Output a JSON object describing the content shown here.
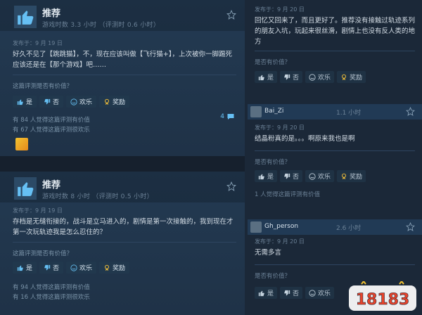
{
  "reviews": [
    {
      "title": "推荐",
      "hours": "游戏时数 3.3 小时 （评测时 0.6 小时）",
      "posted": "发布于：9 月 19 日",
      "text": "好久不见了【跳跳猫】，不，现在应该叫做【飞行猫+】，上次被你一脚踢死应该还是在【那个游戏】吧……",
      "helpful_q": "这篇评测是否有价值？",
      "btn_yes": "是",
      "btn_no": "否",
      "btn_funny": "欢乐",
      "btn_award": "奖励",
      "stat_helpful": "有 84 人觉得这篇评测有价值",
      "stat_funny": "有 67 人觉得这篇评测很欢乐",
      "reply_count": "4"
    },
    {
      "title": "推荐",
      "hours": "游戏时数 8 小时 （评测时 0.5 小时）",
      "posted": "发布于：9 月 19 日",
      "text": "存档是无缝衔接的，战斗是立马进入的，剧情是第一次接触的，我到现在才第一次玩轨迹我是怎么忍住的？",
      "helpful_q": "这篇评测是否有价值？",
      "btn_yes": "是",
      "btn_no": "否",
      "btn_funny": "欢乐",
      "btn_award": "奖励",
      "stat_helpful": "有 94 人觉得这篇评测有价值",
      "stat_funny": "有 16 人觉得这篇评测很欢乐"
    }
  ],
  "comments": [
    {
      "posted": "发布于：9 月 20 日",
      "text": "回忆又回来了，而且更好了。推荐没有接触过轨迹系列的朋友入坑，玩起来很丝滑，剧情上也没有反人类的地方",
      "helpful_q": "是否有价值？",
      "btn_yes": "是",
      "btn_no": "否",
      "btn_funny": "欢乐",
      "btn_award": "奖励"
    },
    {
      "name": "Bai_Zi",
      "hours": "1.1 小时",
      "posted": "发布于：9 月 20 日",
      "text": "结晶粉真的是。。。啊原来我也是啊",
      "helpful_q": "是否有价值？",
      "btn_yes": "是",
      "btn_no": "否",
      "btn_funny": "欢乐",
      "btn_award": "奖励",
      "stat": "1 人觉得这篇评测有价值"
    },
    {
      "name": "Gh_person",
      "hours": "2.6 小时",
      "posted": "发布于：9 月 20 日",
      "text": "无需多言",
      "helpful_q": "是否有价值？",
      "btn_yes": "是",
      "btn_no": "否",
      "btn_funny": "欢乐"
    }
  ],
  "watermark": "18183",
  "colors": {
    "accent": "#66c0f4",
    "award": "#e8b93a"
  }
}
